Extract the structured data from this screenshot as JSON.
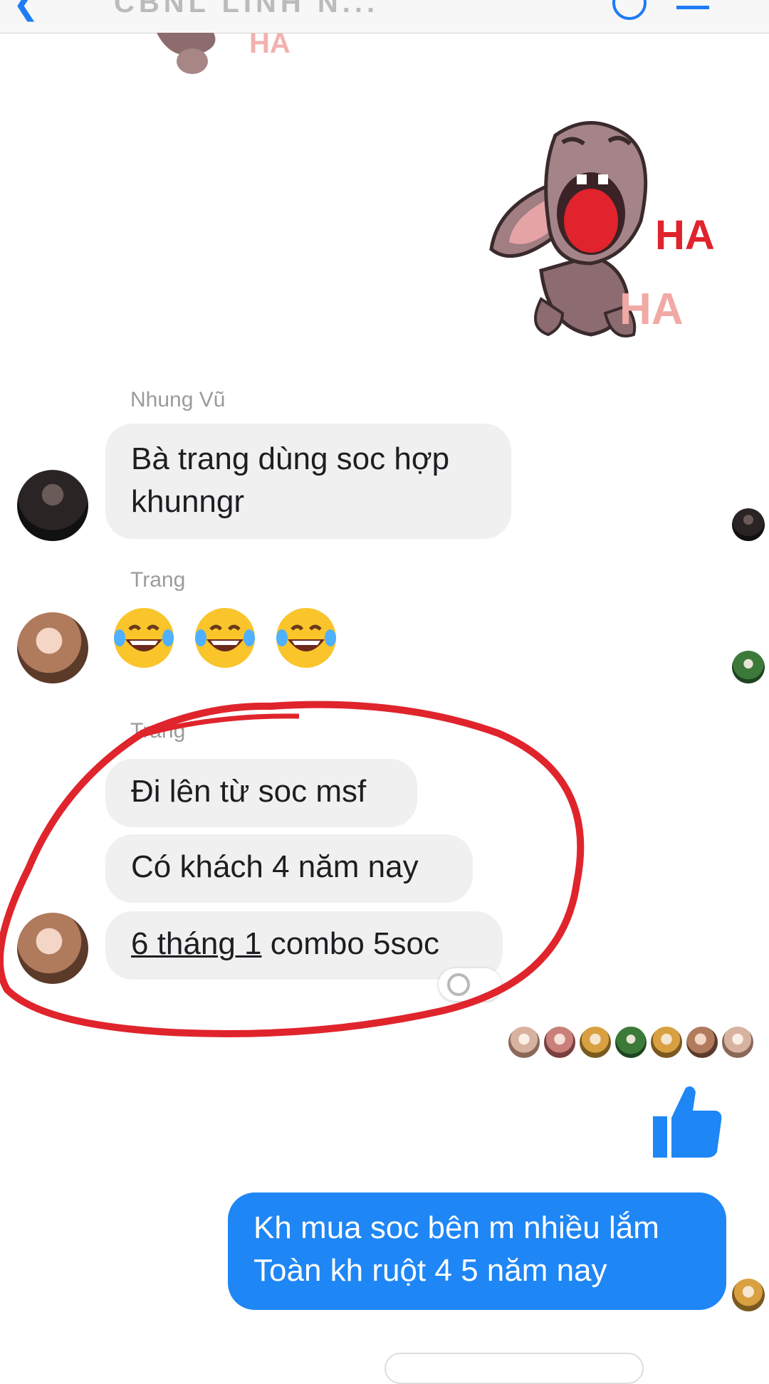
{
  "header": {
    "back_icon": "chevron-left-icon",
    "title": "CBNL LINH N...",
    "call_icon": "phone-icon",
    "menu_icon": "menu-icon"
  },
  "stickers": [
    {
      "name": "laughing-dog-sticker",
      "text": "HA HA"
    }
  ],
  "messages": [
    {
      "sender": "Nhung Vũ",
      "lines": [
        "Bà trang dùng soc hợp",
        "khunngr"
      ]
    },
    {
      "sender": "Trang",
      "emoji": "😂😂😂"
    },
    {
      "sender": "Trang",
      "bubbles": [
        "Đi lên từ soc msf",
        "Có khách 4 năm nay",
        "6 tháng 1 combo 5soc"
      ],
      "link_text": "6 tháng 1"
    },
    {
      "mine": true,
      "lines": [
        "Kh mua soc bên m nhiều lắm",
        "Toàn kh ruột 4 5 năm nay"
      ]
    }
  ],
  "like_icon": "thumbs-up-icon",
  "colors": {
    "accent": "#1f86f5",
    "bubble_grey": "#f0f0f0",
    "annotation_red": "#e0242c"
  }
}
